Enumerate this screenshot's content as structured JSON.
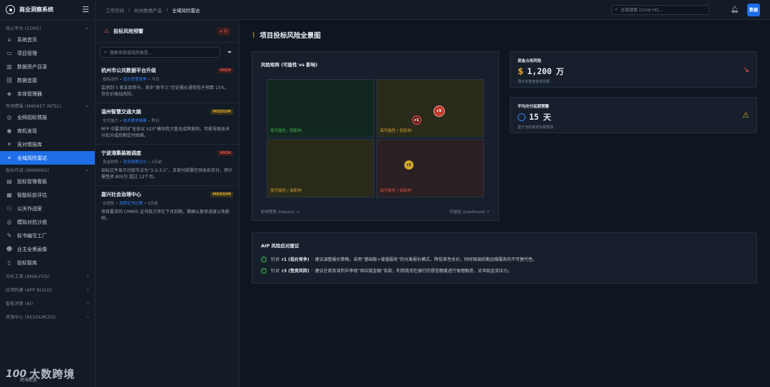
{
  "brand": {
    "name": "商业洞察系统"
  },
  "sidebar": {
    "groups": [
      {
        "label": "核心平台 (CORE)",
        "items": [
          {
            "label": "系统首页",
            "icon": "home-icon"
          },
          {
            "label": "项目管理",
            "icon": "folder-icon"
          },
          {
            "label": "数据资产目录",
            "icon": "chart-icon"
          },
          {
            "label": "数据连接",
            "icon": "link-icon"
          },
          {
            "label": "本体管理器",
            "icon": "box-icon"
          }
        ]
      },
      {
        "label": "市场情报 (MARKET INTEL)",
        "items": [
          {
            "label": "全网招标情报",
            "icon": "globe-icon"
          },
          {
            "label": "商机发现",
            "icon": "compass-icon"
          },
          {
            "label": "竞对情报库",
            "icon": "swords-icon"
          },
          {
            "label": "全域风险雷达",
            "icon": "radar-icon",
            "active": true
          }
        ]
      },
      {
        "label": "投标作战 (WINNING)",
        "items": [
          {
            "label": "投标管理看板",
            "icon": "board-icon"
          },
          {
            "label": "智能标前评估",
            "icon": "doc-icon"
          },
          {
            "label": "公关作战室",
            "icon": "people-icon"
          },
          {
            "label": "模拟对抗沙盘",
            "icon": "target-icon"
          },
          {
            "label": "标书编写工厂",
            "icon": "pen-icon"
          },
          {
            "label": "业主全景画像",
            "icon": "user-icon"
          },
          {
            "label": "投标智库",
            "icon": "book-icon"
          }
        ]
      }
    ],
    "collapsed": [
      "分析工具 (ANALYSIS)",
      "应用构建 (APP BUILD)",
      "智能决策 (AI)",
      "资源中心 (RESOURCES)"
    ]
  },
  "watermark": {
    "mark": "100",
    "sub": "跨境配置",
    "text": "大数跨境"
  },
  "topbar": {
    "crumbs": [
      "工作空间",
      "杭州数据产品",
      "全域风险雷达"
    ],
    "search_placeholder": "全域搜索 (Cmd+K)...",
    "avatar": "数据"
  },
  "alerts": {
    "title": "投标风险预警",
    "count": "4 项",
    "search_placeholder": "搜索项目或风险类型...",
    "items": [
      {
        "title": "杭州市公共数据平台升级",
        "level": "HIGH",
        "type": "投标动作",
        "tag": "低价恶意竞争",
        "time": "今日",
        "desc": "监测到 5 家友商参与，其中“新华三”历史报价通常低于预算 15%，存在价格战风险。"
      },
      {
        "title": "温州智慧交通大脑",
        "level": "MEDIUM",
        "type": "交付能力",
        "tag": "技术要求偏离",
        "time": "昨日",
        "desc": "RFP 中要求的扩充协议 V2X”模块我方暂无成熟案例，可能导致技术分扣分或后期交付困难。"
      },
      {
        "title": "宁波港集装箱调度",
        "level": "HIGH",
        "type": "资金财务",
        "tag": "垫资周期过长",
        "time": "2天前",
        "desc": "招标文件显示付款节点为“3-3-3-1”，且首付款需在验收后支付，预计需垫资 800万 超过 12个月。"
      },
      {
        "title": "嘉兴社会治理中心",
        "level": "MEDIUM",
        "type": "合规性",
        "tag": "资质证书过期",
        "time": "3天前",
        "desc": "项目要求的 CMMI5 证书我方将在下月到期，需确认复审进度以免影响。"
      }
    ]
  },
  "main": {
    "title": "项目投标风险全景图",
    "matrix": {
      "title": "风险矩阵 (可能性 vs 影响)",
      "quadrants": {
        "ll": "低可能性 / 低影响",
        "hl": "高可能性 / 低影响",
        "lh": "低可能性 / 高影响",
        "hh": "高可能性 / 高影响"
      },
      "points": [
        {
          "id": "r3",
          "color": "#e5534b"
        },
        {
          "id": "r1",
          "color": "#e5534b"
        },
        {
          "id": "r2",
          "color": "#d4a72c"
        }
      ],
      "x_label": "影响程度 (Impact) →",
      "y_label": "可能性 (Likelihood) ↑"
    },
    "metric1": {
      "label": "资金占用风险",
      "currency": "$",
      "value": "1,200",
      "unit": "万",
      "sub": "预计本季度垫资总额",
      "trend_icon": "trend-down-icon"
    },
    "metric2": {
      "label": "平均交付延期预警",
      "value": "15",
      "unit": "天",
      "sub": "基于当前资源负载预测",
      "warn_icon": "warning-icon"
    },
    "advice": {
      "title": "AIP 风险应对建议",
      "rows": [
        {
          "prefix": "针对",
          "id": "r1 (低价竞争)",
          "text": "建议调整报价策略，采用“基础版+增值服务”的分离报价模式，降低首性总价，同时强调后期运维服务的不可替代性。"
        },
        {
          "prefix": "针对",
          "id": "r3 (垫资风险)",
          "text": "建议在商务谈判中争取“供应链金融”条款，利用我司在银行的授信额度进行保理融资，对冲现金流压力。"
        }
      ]
    }
  },
  "colors": {
    "accent": "#1e6ee8",
    "high": "#e5534b",
    "medium": "#d4a72c",
    "low": "#3fb950"
  }
}
